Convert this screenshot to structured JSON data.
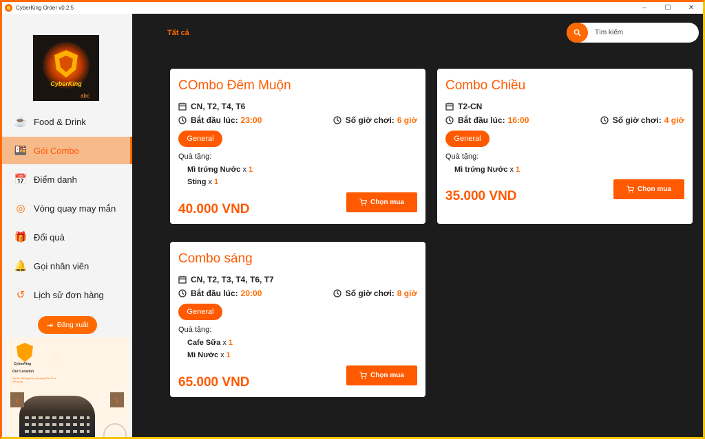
{
  "window": {
    "title": "CyberKing Order v0.2.5",
    "controls": [
      "–",
      "☐",
      "✕"
    ]
  },
  "logo": {
    "brand": "CyberKing",
    "sub": "abc"
  },
  "sidebar": {
    "items": [
      {
        "label": "Food & Drink",
        "icon": "coffee-cup-icon"
      },
      {
        "label": "Gói Combo",
        "icon": "combo-food-icon"
      },
      {
        "label": "Điểm danh",
        "icon": "calendar-icon"
      },
      {
        "label": "Vòng quay may mắn",
        "icon": "lucky-wheel-icon"
      },
      {
        "label": "Đổi quà",
        "icon": "gift-icon"
      },
      {
        "label": "Gọi nhân viên",
        "icon": "bell-icon"
      },
      {
        "label": "Lịch sử đơn hàng",
        "icon": "history-icon"
      }
    ],
    "active_index": 1,
    "logout_label": "Đăng xuất",
    "promo": {
      "brand": "CyberKing",
      "location_title": "Our Location",
      "address": "Số 84, đường 16, phường Phú Thu TP.HCM"
    }
  },
  "main": {
    "filter_tab": "Tất cả",
    "search": {
      "placeholder": "Tìm kiếm"
    },
    "labels": {
      "start": "Bắt đầu lúc:",
      "hours": "Số giờ chơi:",
      "gifts": "Quà tặng:",
      "buy": "Chọn mua",
      "times": "x"
    },
    "combos": [
      {
        "name": "COmbo Đêm Muộn",
        "days": "CN, T2, T4, T6",
        "start_time": "23:00",
        "hours": "6 giờ",
        "badge": "General",
        "gifts": [
          {
            "name": "Mì trứng Nước",
            "qty": "1"
          },
          {
            "name": "Sting",
            "qty": "1"
          }
        ],
        "price": "40.000 VND"
      },
      {
        "name": "Combo Chiều",
        "days": "T2-CN",
        "start_time": "16:00",
        "hours": "4 giờ",
        "badge": "General",
        "gifts": [
          {
            "name": "Mì trứng Nước",
            "qty": "1"
          }
        ],
        "price": "35.000 VND"
      },
      {
        "name": "Combo sáng",
        "days": "CN, T2, T3, T4, T6, T7",
        "start_time": "20:00",
        "hours": "8 giờ",
        "badge": "General",
        "gifts": [
          {
            "name": "Cafe Sữa",
            "qty": "1"
          },
          {
            "name": "Mì Nước",
            "qty": "1"
          }
        ],
        "price": "65.000 VND"
      }
    ]
  },
  "colors": {
    "accent": "#ff5a00",
    "sidebar_bg": "#f4f4f4",
    "main_bg": "#1c1c1c",
    "active_bg": "#f6b98a"
  }
}
